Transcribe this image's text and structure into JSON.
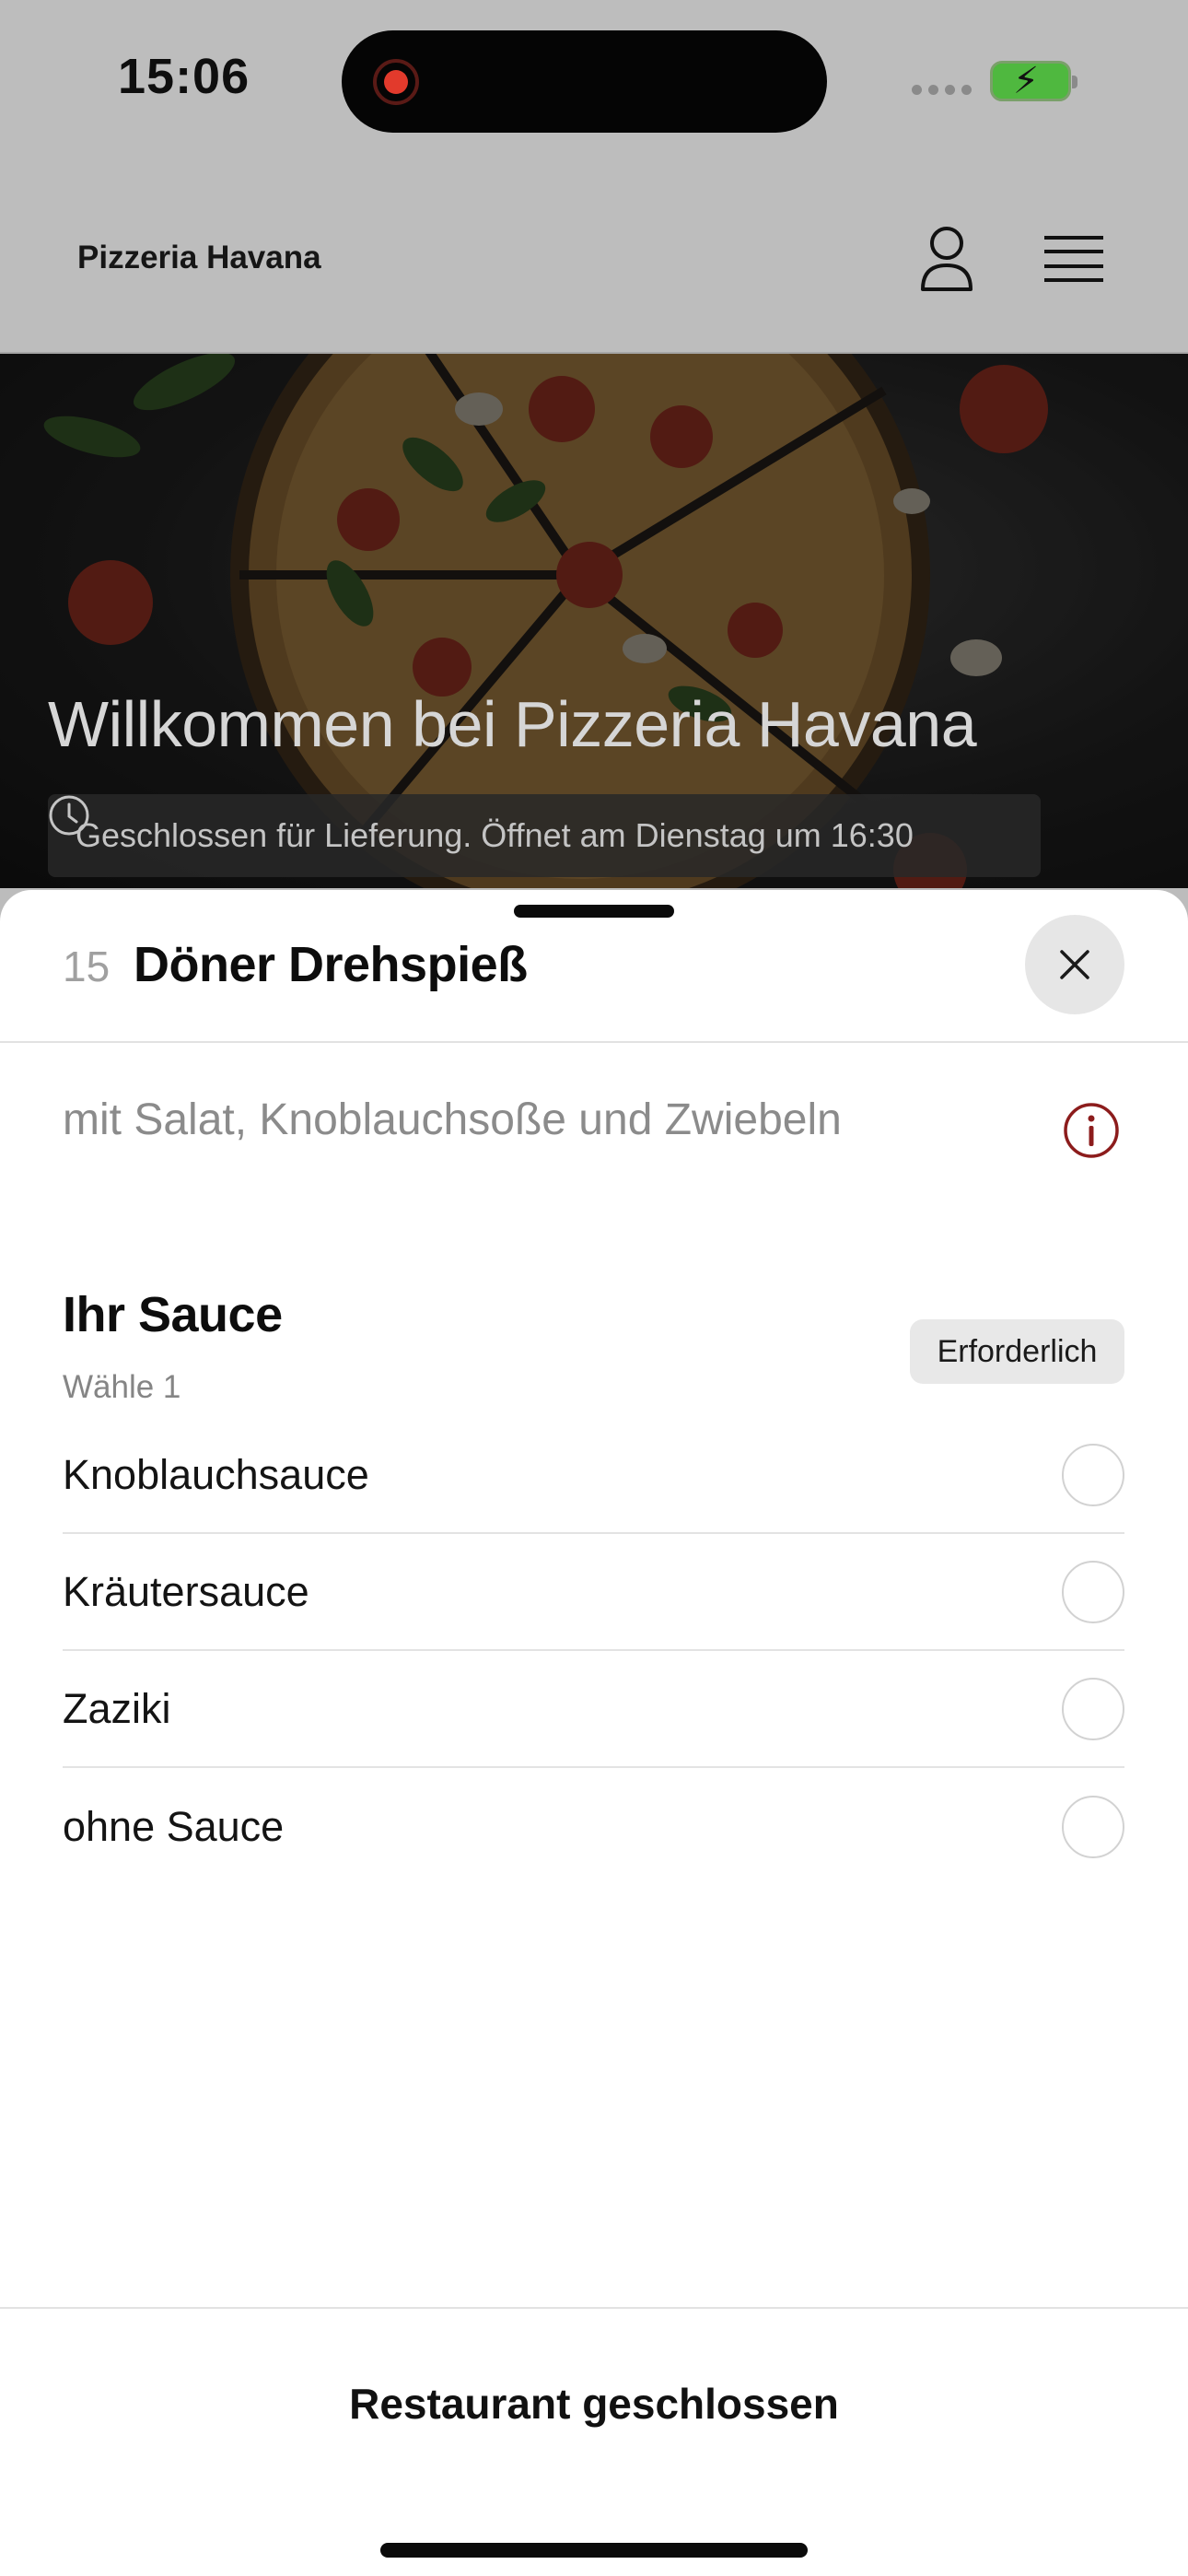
{
  "status_bar": {
    "time": "15:06",
    "battery_color": "#4fb83f",
    "recording_color": "#e23a2c"
  },
  "header": {
    "brand": "Pizzeria Havana",
    "icons": [
      "user-icon",
      "menu-icon"
    ]
  },
  "hero": {
    "title": "Willkommen bei Pizzeria Havana",
    "status_text": "Geschlossen für Lieferung. Öffnet am Dienstag um 16:30",
    "status_icon": "clock-icon"
  },
  "sheet": {
    "item_number": "15",
    "item_title": "Döner Drehspieß",
    "description": "mit Salat, Knoblauchsoße und Zwiebeln",
    "info_icon_color": "#8c1c1c",
    "option_group": {
      "title": "Ihr Sauce",
      "subtitle": "Wähle 1",
      "badge": "Erforderlich",
      "options": [
        {
          "label": "Knoblauchsauce",
          "selected": false
        },
        {
          "label": "Kräutersauce",
          "selected": false
        },
        {
          "label": "Zaziki",
          "selected": false
        },
        {
          "label": "ohne Sauce",
          "selected": false
        }
      ]
    },
    "footer_button": "Restaurant geschlossen"
  }
}
